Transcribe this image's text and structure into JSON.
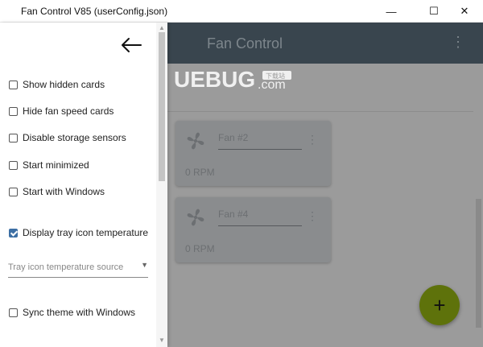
{
  "window": {
    "title": "Fan Control V85 (userConfig.json)",
    "minimize": "—",
    "maximize": "☐",
    "close": "✕"
  },
  "appbar": {
    "title": "Fan Control"
  },
  "watermark": {
    "text": "UEBUG",
    "suffix": ".com",
    "badge": "下载站"
  },
  "drawer": {
    "options": [
      {
        "label": "Show hidden cards",
        "checked": false
      },
      {
        "label": "Hide fan speed cards",
        "checked": false
      },
      {
        "label": "Disable storage sensors",
        "checked": false
      },
      {
        "label": "Start minimized",
        "checked": false
      },
      {
        "label": "Start with Windows",
        "checked": false
      },
      {
        "label": "Display tray icon temperature",
        "checked": true
      },
      {
        "label": "Sync theme with Windows",
        "checked": false
      }
    ],
    "tray_source": {
      "placeholder": "Tray icon temperature source"
    }
  },
  "cards": [
    {
      "name": "Fan #2",
      "rpm": "0 RPM"
    },
    {
      "name": "Fan #4",
      "rpm": "0 RPM"
    }
  ],
  "fab": {
    "label": "+"
  },
  "colors": {
    "appbar": "#39454e",
    "fab": "#5e720b",
    "checkbox": "#3d6fa4"
  },
  "icons": [
    "back-arrow-icon",
    "fan-icon",
    "more-vert-icon",
    "add-icon",
    "dropdown-caret-icon"
  ]
}
